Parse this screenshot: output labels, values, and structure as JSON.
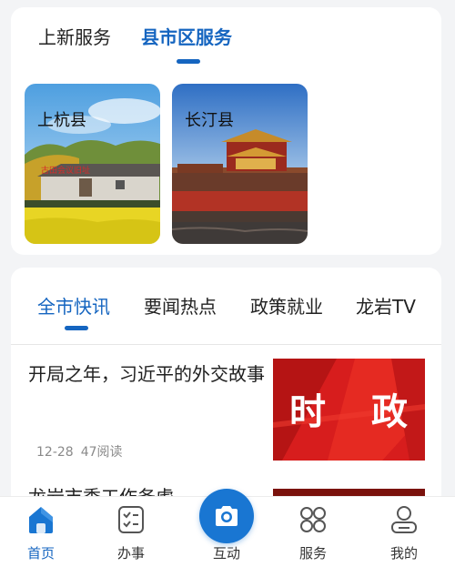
{
  "services": {
    "tabs": [
      {
        "label": "上新服务",
        "active": false
      },
      {
        "label": "县市区服务",
        "active": true
      }
    ],
    "counties": [
      {
        "name": "上杭县"
      },
      {
        "name": "长汀县"
      }
    ]
  },
  "news": {
    "tabs": [
      {
        "label": "全市快讯",
        "active": true
      },
      {
        "label": "要闻热点",
        "active": false
      },
      {
        "label": "政策就业",
        "active": false
      },
      {
        "label": "龙岩TV",
        "active": false
      }
    ],
    "articles": [
      {
        "title": "开局之年，习近平的外交故事",
        "date": "12-28",
        "reads": "47阅读",
        "thumb_text_left": "时",
        "thumb_text_right": "政"
      },
      {
        "title": "龙岩市委工作务虚"
      }
    ]
  },
  "bottom_nav": {
    "items": [
      {
        "label": "首页",
        "icon": "home-icon",
        "active": true
      },
      {
        "label": "办事",
        "icon": "checklist-icon",
        "active": false
      },
      {
        "label": "互动",
        "icon": "camera-icon",
        "active": false
      },
      {
        "label": "服务",
        "icon": "grid-icon",
        "active": false
      },
      {
        "label": "我的",
        "icon": "user-icon",
        "active": false
      }
    ]
  },
  "colors": {
    "accent": "#1565c0",
    "fab": "#1976d2",
    "thumb_red": "#d71d1d"
  }
}
